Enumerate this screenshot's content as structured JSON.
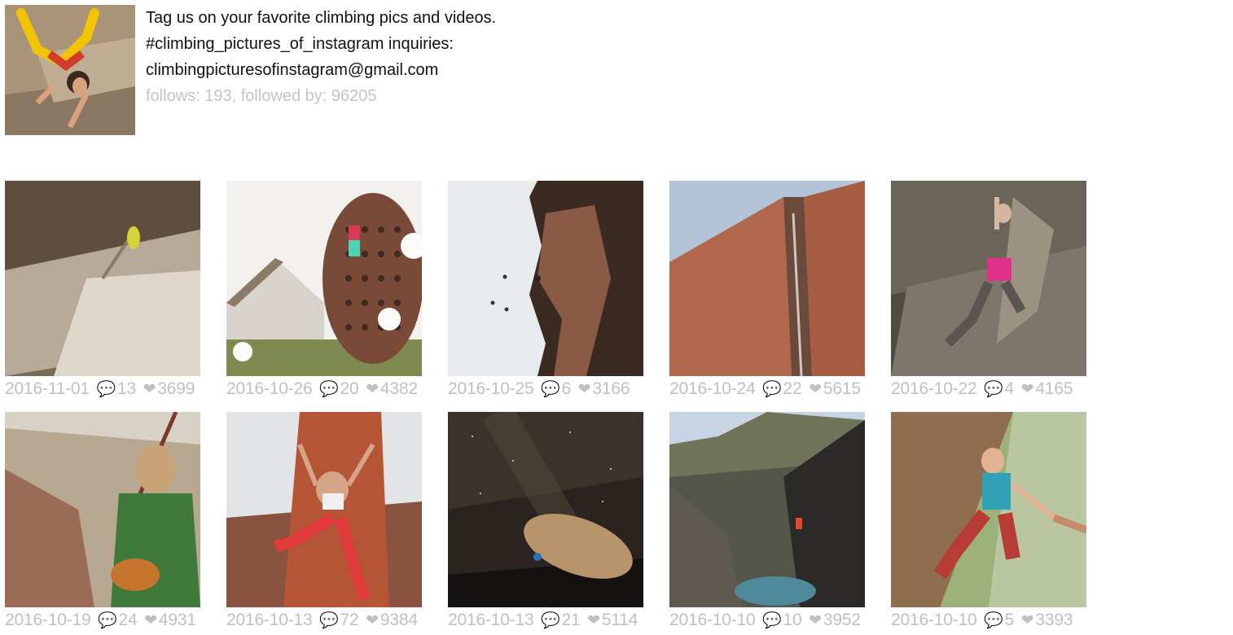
{
  "profile": {
    "avatar_icon": "climber-avatar-photo",
    "bio_line1": "Tag us on your favorite climbing pics and videos.",
    "bio_line2": "#climbing_pictures_of_instagram inquiries:",
    "bio_line3": "climbingpicturesofinstagram@gmail.com",
    "stats": "follows: 193, followed by: 96205"
  },
  "icons": {
    "comment": "💬",
    "heart": "❤"
  },
  "posts": [
    {
      "date": "2016-11-01",
      "comments": "13",
      "likes": "3699"
    },
    {
      "date": "2016-10-26",
      "comments": "20",
      "likes": "4382"
    },
    {
      "date": "2016-10-25",
      "comments": "6",
      "likes": "3166"
    },
    {
      "date": "2016-10-24",
      "comments": "22",
      "likes": "5615"
    },
    {
      "date": "2016-10-22",
      "comments": "4",
      "likes": "4165"
    },
    {
      "date": "2016-10-19",
      "comments": "24",
      "likes": "4931"
    },
    {
      "date": "2016-10-13",
      "comments": "72",
      "likes": "9384"
    },
    {
      "date": "2016-10-13",
      "comments": "21",
      "likes": "5114"
    },
    {
      "date": "2016-10-10",
      "comments": "10",
      "likes": "3952"
    },
    {
      "date": "2016-10-10",
      "comments": "5",
      "likes": "3393"
    }
  ]
}
